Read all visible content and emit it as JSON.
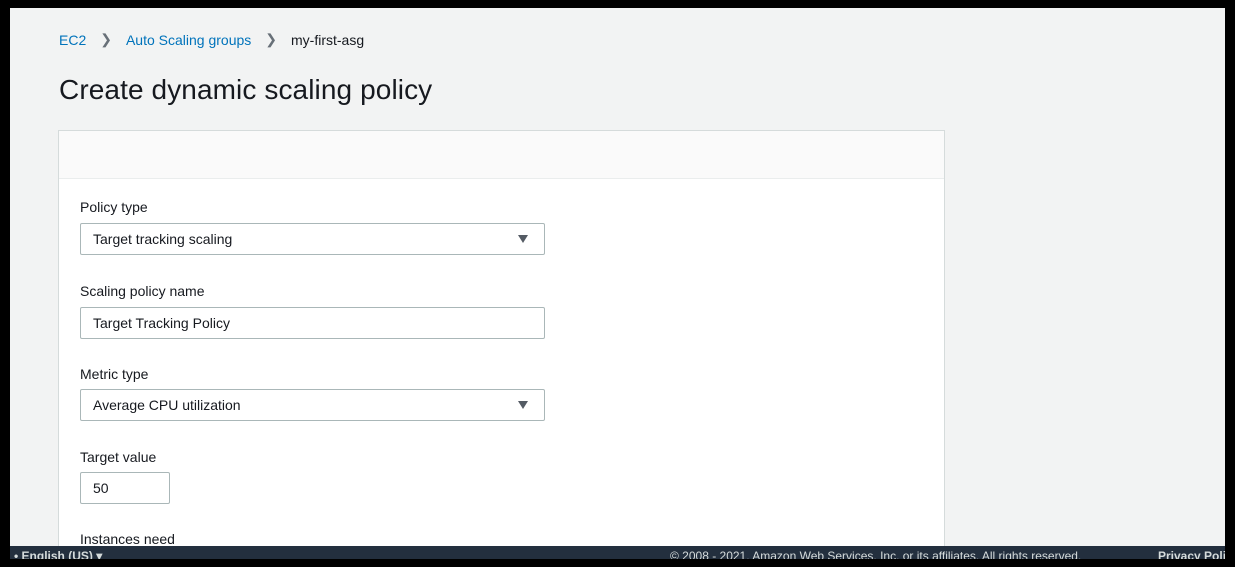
{
  "breadcrumb": {
    "items": [
      "EC2",
      "Auto Scaling groups",
      "my-first-asg"
    ]
  },
  "page": {
    "title": "Create dynamic scaling policy"
  },
  "form": {
    "policy_type": {
      "label": "Policy type",
      "value": "Target tracking scaling"
    },
    "policy_name": {
      "label": "Scaling policy name",
      "value": "Target Tracking Policy"
    },
    "metric_type": {
      "label": "Metric type",
      "value": "Average CPU utilization"
    },
    "target_value": {
      "label": "Target value",
      "value": "50"
    },
    "instances_need": {
      "label": "Instances need"
    }
  },
  "footer": {
    "language": "• English (US) ▾",
    "copyright": "© 2008 - 2021, Amazon Web Services, Inc. or its affiliates. All rights reserved.",
    "privacy": "Privacy Poli"
  }
}
